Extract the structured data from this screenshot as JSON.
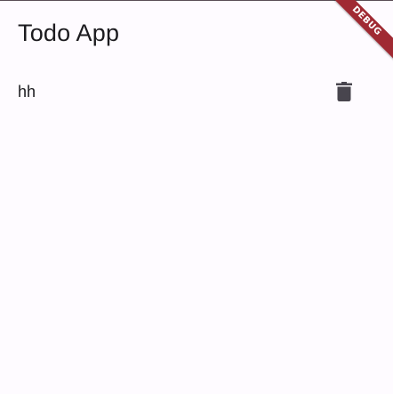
{
  "app_bar": {
    "title": "Todo App"
  },
  "todos": [
    {
      "text": "hh",
      "action_icon": "trash-icon"
    }
  ],
  "debug_banner": {
    "label": "DEBUG"
  },
  "colors": {
    "background": "#fefbff",
    "text": "#1c1b1f",
    "icon": "#48454e",
    "banner": "#a02a33"
  }
}
